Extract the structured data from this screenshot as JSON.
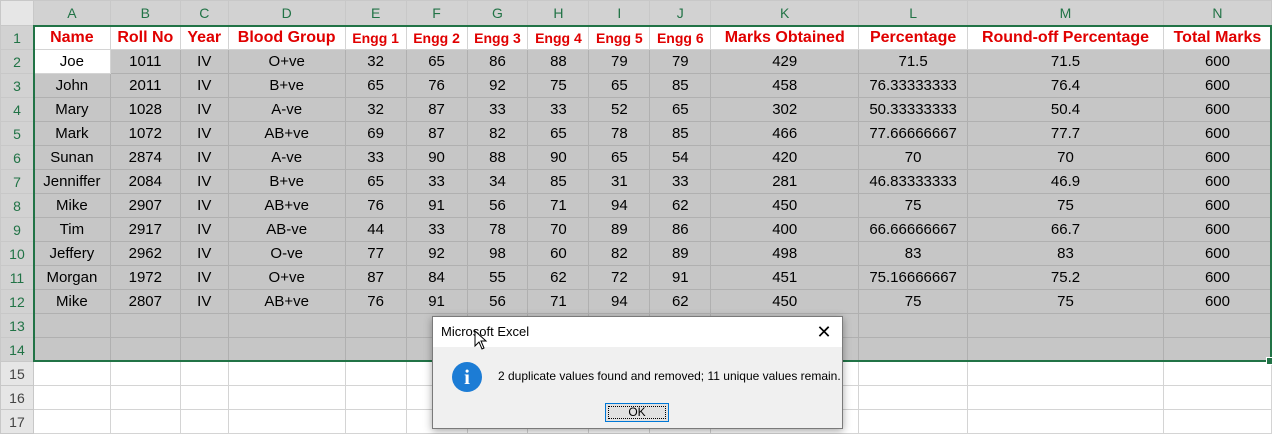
{
  "columns": [
    "A",
    "B",
    "C",
    "D",
    "E",
    "F",
    "G",
    "H",
    "I",
    "J",
    "K",
    "L",
    "M",
    "N"
  ],
  "rows": [
    "1",
    "2",
    "3",
    "4",
    "5",
    "6",
    "7",
    "8",
    "9",
    "10",
    "11",
    "12",
    "13",
    "14",
    "15",
    "16",
    "17"
  ],
  "headers": [
    "Name",
    "Roll No",
    "Year",
    "Blood Group",
    "Engg 1",
    "Engg 2",
    "Engg 3",
    "Engg 4",
    "Engg 5",
    "Engg 6",
    "Marks Obtained",
    "Percentage",
    "Round-off Percentage",
    "Total Marks"
  ],
  "data": [
    [
      "Joe",
      "1011",
      "IV",
      "O+ve",
      "32",
      "65",
      "86",
      "88",
      "79",
      "79",
      "429",
      "71.5",
      "71.5",
      "600"
    ],
    [
      "John",
      "2011",
      "IV",
      "B+ve",
      "65",
      "76",
      "92",
      "75",
      "65",
      "85",
      "458",
      "76.33333333",
      "76.4",
      "600"
    ],
    [
      "Mary",
      "1028",
      "IV",
      "A-ve",
      "32",
      "87",
      "33",
      "33",
      "52",
      "65",
      "302",
      "50.33333333",
      "50.4",
      "600"
    ],
    [
      "Mark",
      "1072",
      "IV",
      "AB+ve",
      "69",
      "87",
      "82",
      "65",
      "78",
      "85",
      "466",
      "77.66666667",
      "77.7",
      "600"
    ],
    [
      "Sunan",
      "2874",
      "IV",
      "A-ve",
      "33",
      "90",
      "88",
      "90",
      "65",
      "54",
      "420",
      "70",
      "70",
      "600"
    ],
    [
      "Jenniffer",
      "2084",
      "IV",
      "B+ve",
      "65",
      "33",
      "34",
      "85",
      "31",
      "33",
      "281",
      "46.83333333",
      "46.9",
      "600"
    ],
    [
      "Mike",
      "2907",
      "IV",
      "AB+ve",
      "76",
      "91",
      "56",
      "71",
      "94",
      "62",
      "450",
      "75",
      "75",
      "600"
    ],
    [
      "Tim",
      "2917",
      "IV",
      "AB-ve",
      "44",
      "33",
      "78",
      "70",
      "89",
      "86",
      "400",
      "66.66666667",
      "66.7",
      "600"
    ],
    [
      "Jeffery",
      "2962",
      "IV",
      "O-ve",
      "77",
      "92",
      "98",
      "60",
      "82",
      "89",
      "498",
      "83",
      "83",
      "600"
    ],
    [
      "Morgan",
      "1972",
      "IV",
      "O+ve",
      "87",
      "84",
      "55",
      "62",
      "72",
      "91",
      "451",
      "75.16666667",
      "75.2",
      "600"
    ],
    [
      "Mike",
      "2807",
      "IV",
      "AB+ve",
      "76",
      "91",
      "56",
      "71",
      "94",
      "62",
      "450",
      "75",
      "75",
      "600"
    ]
  ],
  "dialog": {
    "title": "Microsoft Excel",
    "message": "2 duplicate values found and removed; 11 unique values remain.",
    "ok_label": "OK",
    "close_glyph": "✕",
    "icon_glyph": "i"
  },
  "colors": {
    "header_text": "#e00000",
    "selection_border": "#217346",
    "selection_fill": "#c6c6c6",
    "info_icon": "#1c7cd5"
  }
}
